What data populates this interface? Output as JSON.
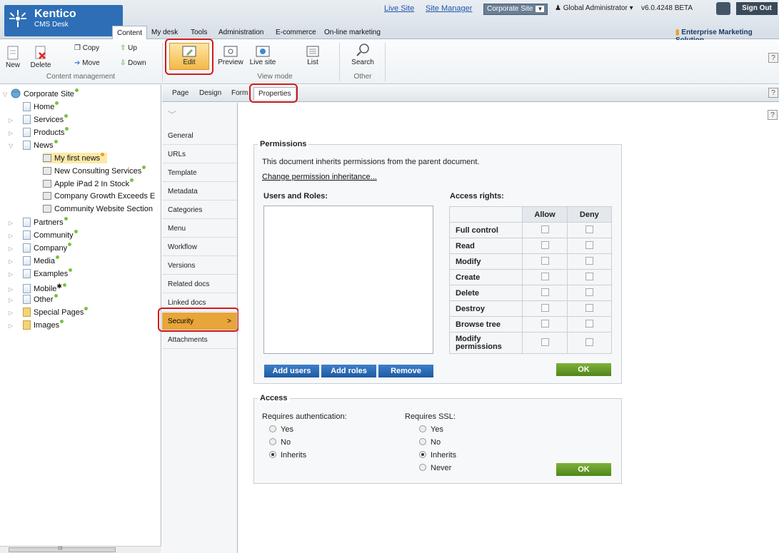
{
  "header": {
    "logo_name": "Kentico",
    "logo_sub": "CMS Desk",
    "tabs": [
      "Content",
      "My desk",
      "Tools",
      "Administration",
      "E-commerce",
      "On-line marketing"
    ],
    "active_tab": "Content",
    "links": [
      "Live Site",
      "Site Manager"
    ],
    "site_selector": "Corporate Site",
    "user": "Global Administrator",
    "version": "v6.0.4248 BETA",
    "sign_out": "Sign Out",
    "edition": "Enterprise Marketing Solution"
  },
  "toolbar": {
    "new": "New",
    "delete": "Delete",
    "copy": "Copy",
    "move": "Move",
    "up": "Up",
    "down": "Down",
    "group_content": "Content management",
    "edit": "Edit",
    "preview": "Preview",
    "live_site": "Live site",
    "list": "List",
    "group_view": "View mode",
    "search": "Search",
    "group_other": "Other",
    "help": "?"
  },
  "tree": {
    "root": "Corporate Site",
    "items": [
      "Home",
      "Services",
      "Products",
      "News",
      "My first news",
      "New Consulting Services",
      "Apple iPad 2 In Stock",
      "Company Growth Exceeds E",
      "Community Website Section",
      "Partners",
      "Community",
      "Company",
      "Media",
      "Examples",
      "Mobile",
      "Other",
      "Special Pages",
      "Images"
    ],
    "scroll_glyph": "III"
  },
  "subtabs": [
    "Page",
    "Design",
    "Form",
    "Properties"
  ],
  "vnav": [
    "General",
    "URLs",
    "Template",
    "Metadata",
    "Categories",
    "Menu",
    "Workflow",
    "Versions",
    "Related docs",
    "Linked docs",
    "Security",
    "Attachments"
  ],
  "vnav_active_chevron": ">",
  "permissions": {
    "legend": "Permissions",
    "inherit_text": "This document inherits permissions from the parent document.",
    "change_link": "Change permission inheritance...",
    "users_roles_label": "Users and Roles:",
    "access_rights_label": "Access rights:",
    "col_allow": "Allow",
    "col_deny": "Deny",
    "rights": [
      "Full control",
      "Read",
      "Modify",
      "Create",
      "Delete",
      "Destroy",
      "Browse tree",
      "Modify permissions"
    ],
    "add_users": "Add users",
    "add_roles": "Add roles",
    "remove": "Remove",
    "ok": "OK"
  },
  "access": {
    "legend": "Access",
    "auth_label": "Requires authentication:",
    "auth_options": [
      "Yes",
      "No",
      "Inherits"
    ],
    "auth_selected": "Inherits",
    "ssl_label": "Requires SSL:",
    "ssl_options": [
      "Yes",
      "No",
      "Inherits",
      "Never"
    ],
    "ssl_selected": "Inherits",
    "ok": "OK"
  }
}
